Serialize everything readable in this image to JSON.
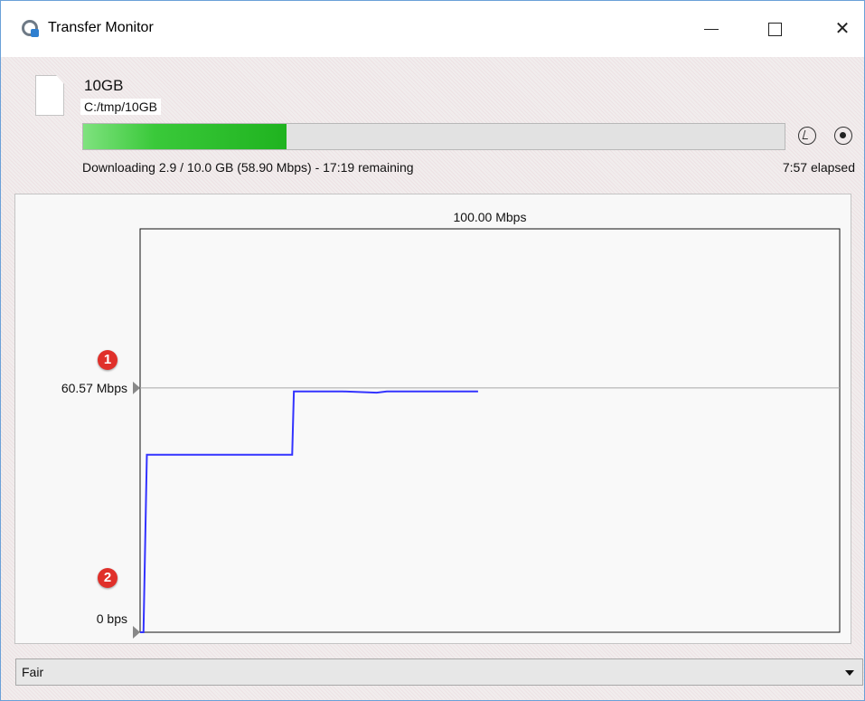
{
  "window": {
    "title": "Transfer Monitor"
  },
  "file": {
    "name": "10GB",
    "path": "C:/tmp/10GB"
  },
  "progress": {
    "fraction": 0.29,
    "color": "#2db82d"
  },
  "status": {
    "text": "Downloading 2.9 / 10.0 GB (58.90 Mbps) - 17:19 remaining",
    "elapsed": "7:57 elapsed"
  },
  "icons": {
    "app": "transfer-monitor-icon",
    "file": "file-icon",
    "limit": "speed-limit-icon",
    "stop": "stop-icon"
  },
  "chart_data": {
    "type": "line",
    "max_label": "100.00 Mbps",
    "current_label": "60.57 Mbps",
    "min_label": "0 bps",
    "ylim": [
      0,
      100
    ],
    "current_value": 60.57,
    "line_color": "#3333ff",
    "series": [
      {
        "x": [
          0,
          1,
          2,
          10,
          20,
          30,
          40,
          45,
          45.5,
          50,
          60,
          70,
          73,
          80,
          100
        ],
        "values": [
          0,
          0,
          44,
          44,
          44,
          44,
          44,
          44,
          59.7,
          59.7,
          59.7,
          59.4,
          59.7,
          59.7,
          59.7
        ]
      }
    ],
    "xlim": [
      0,
      207
    ],
    "markers": [
      "1",
      "2"
    ]
  },
  "quality": {
    "selected": "Fair"
  }
}
